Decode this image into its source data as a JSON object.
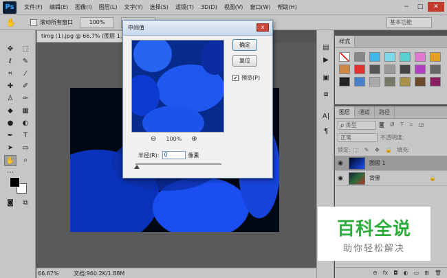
{
  "menubar": {
    "logo": "Ps",
    "items": [
      "文件(F)",
      "编辑(E)",
      "图像(I)",
      "图层(L)",
      "文字(Y)",
      "选择(S)",
      "滤镜(T)",
      "3D(D)",
      "视图(V)",
      "窗口(W)",
      "帮助(H)"
    ],
    "min": "−",
    "max": "□",
    "close": "✕"
  },
  "options": {
    "scroll_all_label": "滚动所有窗口",
    "zoom_100": "100%",
    "workspace": "基本功能"
  },
  "document": {
    "tab_title": "timg (1).jpg @ 66.7% (图层 1, RGB",
    "zoom_status": "66.67%",
    "doc_status": "文档:960.2K/1.88M"
  },
  "styles_panel": {
    "tab": "样式"
  },
  "layers_panel": {
    "tabs": [
      "图层",
      "通道",
      "路径"
    ],
    "filter_placeholder": "ρ 类型",
    "blend_mode": "正常",
    "opacity_label": "不透明度:",
    "lock_label": "锁定:",
    "fill_label": "填充:",
    "layers": [
      {
        "name": "图层 1",
        "selected": true
      },
      {
        "name": "背景",
        "selected": false
      }
    ]
  },
  "dialog": {
    "title": "中间值",
    "close_label": "x",
    "ok_label": "确定",
    "reset_label": "复位",
    "preview_label": "预览(P)",
    "preview_checked": "✔",
    "zoom_level": "100%",
    "zoom_out": "⊖",
    "zoom_in": "⊕",
    "radius_label": "半径(R):",
    "radius_value": "0",
    "radius_unit": "像素"
  },
  "watermark": {
    "title": "百科全说",
    "subtitle": "助你轻松解决"
  }
}
